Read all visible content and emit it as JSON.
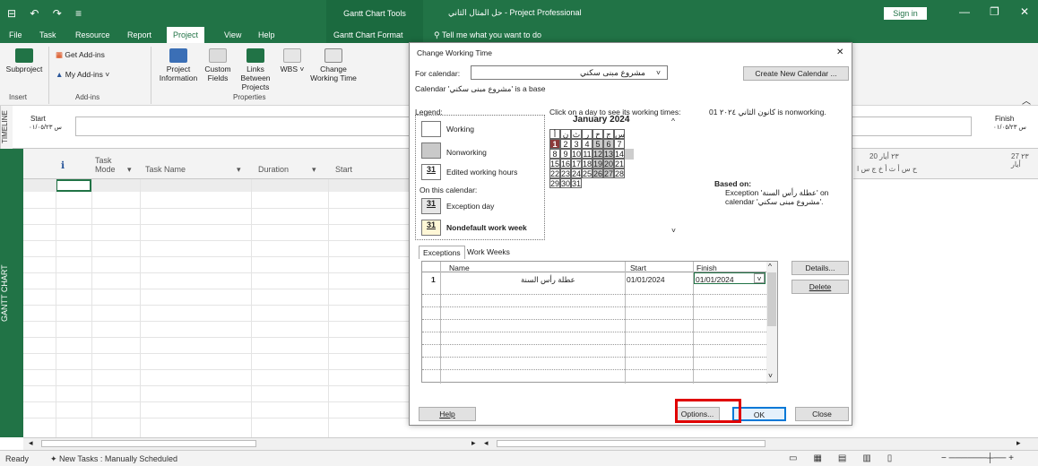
{
  "titlebar": {
    "qat": "⊟ ↶ ↷ ≡",
    "context_tab": "Gantt Chart Tools",
    "window_title": "حل المثال الثاني  -  Project Professional",
    "sign_in": "Sign in",
    "minimize": "—",
    "restore": "❐",
    "close": "✕"
  },
  "tabs": [
    "File",
    "Task",
    "Resource",
    "Report",
    "Project",
    "View",
    "Help",
    "Gantt Chart Format"
  ],
  "active_tab": "Project",
  "tell_me": "Tell me what you want to do",
  "ribbon": {
    "subproject": "Subproject",
    "insert_group": "Insert",
    "get_addins": "Get Add-ins",
    "my_addins": "My Add-ins",
    "addins_group": "Add-ins",
    "project_info": "Project Information",
    "custom_fields": "Custom Fields",
    "links_between": "Links Between Projects",
    "wbs": "WBS",
    "change_wt": "Change Working Time",
    "properties_group": "Properties"
  },
  "timeline": {
    "side": "TIMELINE",
    "start_label": "Start",
    "start_date": "س ٠١/٠٥/٢٣",
    "finish_label": "Finish",
    "finish_date": "س ٠١/٠٥/٢٣"
  },
  "grid": {
    "info_col": "ℹ",
    "task_mode": "Task Mode",
    "task_name": "Task Name",
    "duration": "Duration",
    "start": "Start",
    "side": "GANTT CHART"
  },
  "chart_header": {
    "week": "20 ٢٣ أيار",
    "week2": "27 ٢٣ أيار",
    "days": "ح  س  أ  ث  أ  خ  ج  س  ا"
  },
  "status": {
    "ready": "Ready",
    "new_tasks": "New Tasks : Manually Scheduled"
  },
  "dialog": {
    "title": "Change Working Time",
    "close": "✕",
    "for_calendar_label": "For calendar:",
    "calendar_value": "مشروع مبنى سكني",
    "calendar_base": "Calendar 'مشروع مبنى سكني' is a base",
    "create_new": "Create New Calendar ...",
    "legend_title": "Legend:",
    "working": "Working",
    "nonworking": "Nonworking",
    "edited": "Edited working hours",
    "on_this": "On this calendar:",
    "exception_day": "Exception day",
    "nondefault": "Nondefault work week",
    "day31": "31",
    "click_text": "Click on a day to see its working times:",
    "nonworking_msg": "01 كانون الثاني ٢٠٢٤ is nonworking.",
    "month": "January 2024",
    "weekdays": [
      "أ",
      "ن",
      "ث",
      "ر",
      "خ",
      "ج",
      "س"
    ],
    "days": [
      "1",
      "2",
      "3",
      "4",
      "5",
      "6",
      "7",
      "8",
      "9",
      "10",
      "11",
      "12",
      "13",
      "14",
      "15",
      "16",
      "17",
      "18",
      "19",
      "20",
      "21",
      "22",
      "23",
      "24",
      "25",
      "26",
      "27",
      "28",
      "29",
      "30",
      "31"
    ],
    "based_on": "Based on:",
    "exception_line1": "Exception 'عطلة رأس السنة' on",
    "exception_line2": "calendar 'مشروع مبنى سكني'.",
    "tab_exceptions": "Exceptions",
    "tab_workweeks": "Work Weeks",
    "col_name": "Name",
    "col_start": "Start",
    "col_finish": "Finish",
    "row1": {
      "num": "1",
      "name": "عطلة رأس السنة",
      "start": "01/01/2024",
      "finish": "01/01/2024"
    },
    "details": "Details...",
    "delete": "Delete",
    "help": "Help",
    "options": "Options...",
    "ok": "OK",
    "close_btn": "Close"
  },
  "colors": {
    "green": "#217346",
    "red_highlight": "#e00000",
    "exception_day": "#8b3a3a"
  }
}
